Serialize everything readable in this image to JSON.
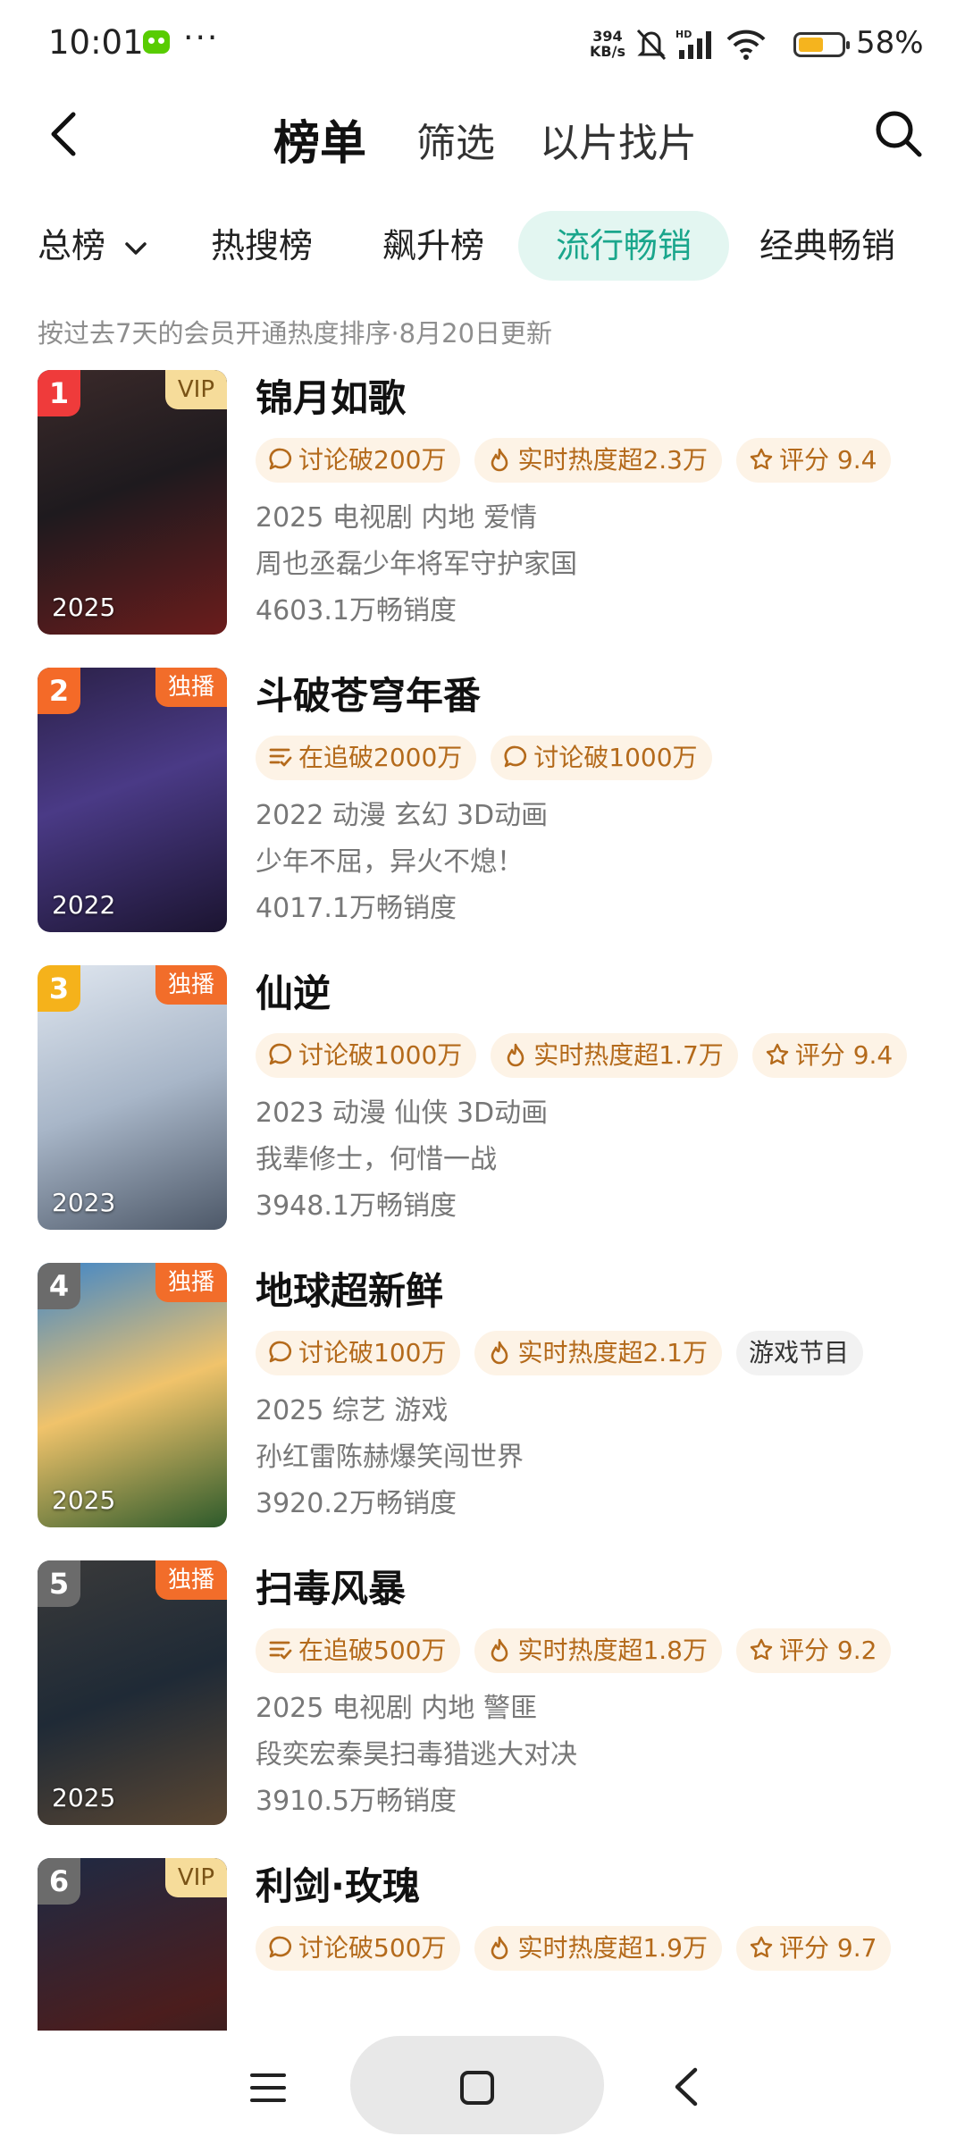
{
  "status_bar": {
    "time": "10:01",
    "more": "···",
    "net_speed_value": "394",
    "net_speed_unit": "KB/s",
    "battery": "58%",
    "battery_level": 0.58
  },
  "header": {
    "title": "榜单",
    "tab_filter": "筛选",
    "tab_find_by_clip": "以片找片"
  },
  "chips": [
    "总榜",
    "热搜榜",
    "飙升榜",
    "流行畅销",
    "经典畅销"
  ],
  "active_chip": "流行畅销",
  "subtitle": "按过去7天的会员开通热度排序·8月20日更新",
  "items": [
    {
      "rank": "1",
      "badge": "VIP",
      "year": "2025",
      "title": "锦月如歌",
      "tags": [
        {
          "icon": "comment-icon",
          "text": "讨论破200万"
        },
        {
          "icon": "flame-icon",
          "text": "实时热度超2.3万"
        },
        {
          "icon": "star-icon",
          "text": "评分 9.4"
        }
      ],
      "genre": "2025 电视剧 内地 爱情",
      "desc": "周也丞磊少年将军守护家国",
      "sales": "4603.1万畅销度"
    },
    {
      "rank": "2",
      "badge": "独播",
      "year": "2022",
      "title": "斗破苍穹年番",
      "tags": [
        {
          "icon": "list-icon",
          "text": "在追破2000万"
        },
        {
          "icon": "comment-icon",
          "text": "讨论破1000万"
        }
      ],
      "genre": "2022 动漫 玄幻 3D动画",
      "desc": "少年不屈，异火不熄！",
      "sales": "4017.1万畅销度"
    },
    {
      "rank": "3",
      "badge": "独播",
      "year": "2023",
      "title": "仙逆",
      "tags": [
        {
          "icon": "comment-icon",
          "text": "讨论破1000万"
        },
        {
          "icon": "flame-icon",
          "text": "实时热度超1.7万"
        },
        {
          "icon": "star-icon",
          "text": "评分 9.4"
        }
      ],
      "genre": "2023 动漫 仙侠 3D动画",
      "desc": "我辈修士，何惜一战",
      "sales": "3948.1万畅销度"
    },
    {
      "rank": "4",
      "badge": "独播",
      "year": "2025",
      "title": "地球超新鲜",
      "tags": [
        {
          "icon": "comment-icon",
          "text": "讨论破100万"
        },
        {
          "icon": "flame-icon",
          "text": "实时热度超2.1万"
        },
        {
          "icon": "",
          "text": "游戏节目"
        }
      ],
      "genre": "2025 综艺 游戏",
      "desc": "孙红雷陈赫爆笑闯世界",
      "sales": "3920.2万畅销度"
    },
    {
      "rank": "5",
      "badge": "独播",
      "year": "2025",
      "title": "扫毒风暴",
      "tags": [
        {
          "icon": "list-icon",
          "text": "在追破500万"
        },
        {
          "icon": "flame-icon",
          "text": "实时热度超1.8万"
        },
        {
          "icon": "star-icon",
          "text": "评分 9.2"
        }
      ],
      "genre": "2025 电视剧 内地 警匪",
      "desc": "段奕宏秦昊扫毒猎逃大对决",
      "sales": "3910.5万畅销度"
    },
    {
      "rank": "6",
      "badge": "VIP",
      "year": "",
      "title": "利剑·玫瑰",
      "tags": [
        {
          "icon": "comment-icon",
          "text": "讨论破500万"
        },
        {
          "icon": "flame-icon",
          "text": "实时热度超1.9万"
        },
        {
          "icon": "star-icon",
          "text": "评分 9.7"
        }
      ],
      "genre": "",
      "desc": "",
      "sales": ""
    }
  ],
  "colors": {
    "accent": "#1aa68c",
    "accent_bg": "#e3f6f1",
    "tag_text": "#b46a1b",
    "tag_bg": "#fdf3e6",
    "vip_bg": "#f6dc9a",
    "exclusive_bg": "#f26d2a",
    "rank_colors": [
      "#ef3b3b",
      "#f46a28",
      "#f5b21b",
      "#6b6b6b",
      "#6b6b6b",
      "#6b6b6b"
    ]
  }
}
